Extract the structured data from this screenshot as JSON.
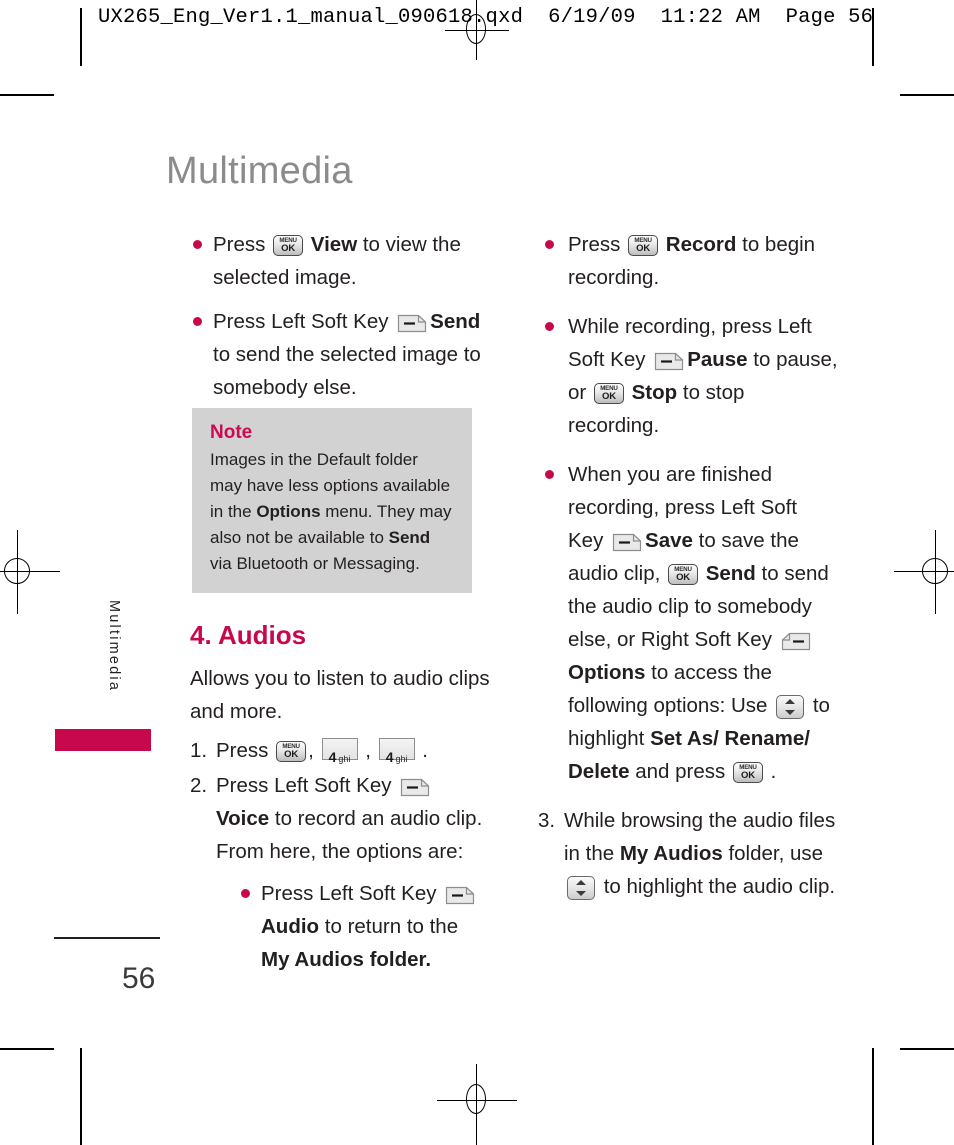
{
  "slug": "UX265_Eng_Ver1.1_manual_090618.qxd  6/19/09  11:22 AM  Page 56",
  "page_title": "Multimedia",
  "side_tab_label": "Multimedia",
  "page_number": "56",
  "accent_color": "#c8084c",
  "note_title_color": "#cc0a52",
  "note_bg_color": "#d2d2d2",
  "title_color": "#8b8b8b",
  "icons": {
    "menuok": {
      "line1": "MENU",
      "line2": "OK"
    },
    "left_soft_key": "left-soft-key",
    "right_soft_key": "right-soft-key",
    "nav_up_down": "up-down-nav-key",
    "key_4": {
      "digit": "4",
      "letters": "ghi"
    }
  },
  "left_column": {
    "bullets": [
      {
        "parts": [
          {
            "t": "text",
            "v": "Press "
          },
          {
            "t": "key",
            "v": "menuok"
          },
          {
            "t": "bold",
            "v": " View"
          },
          {
            "t": "text",
            "v": " to view the selected image."
          }
        ]
      },
      {
        "parts": [
          {
            "t": "text",
            "v": "Press Left Soft Key "
          },
          {
            "t": "key",
            "v": "leftsoft"
          },
          {
            "t": "bold",
            "v": "Send"
          },
          {
            "t": "text",
            "v": " to send the selected image to somebody else."
          }
        ]
      }
    ]
  },
  "note": {
    "title": "Note",
    "parts": [
      {
        "t": "text",
        "v": "Images in the Default folder may have less options available in the "
      },
      {
        "t": "bold",
        "v": "Options"
      },
      {
        "t": "text",
        "v": " menu. They may also not be available to "
      },
      {
        "t": "bold",
        "v": "Send"
      },
      {
        "t": "text",
        "v": " via Bluetooth or Messaging."
      }
    ]
  },
  "section": {
    "heading": "4. Audios",
    "intro": "Allows you to listen to audio clips and more.",
    "steps": [
      {
        "number": "1.",
        "parts": [
          {
            "t": "text",
            "v": "Press "
          },
          {
            "t": "key",
            "v": "menuok"
          },
          {
            "t": "text",
            "v": ", "
          },
          {
            "t": "key",
            "v": "key4"
          },
          {
            "t": "text",
            "v": " , "
          },
          {
            "t": "key",
            "v": "key4"
          },
          {
            "t": "text",
            "v": " ."
          }
        ]
      },
      {
        "number": "2.",
        "parts": [
          {
            "t": "text",
            "v": "Press Left Soft Key "
          },
          {
            "t": "key",
            "v": "leftsoft"
          },
          {
            "t": "bold",
            "v": " Voice"
          },
          {
            "t": "text",
            "v": " to record an audio clip. From here, the options are:"
          }
        ],
        "sub_bullets": [
          {
            "parts": [
              {
                "t": "text",
                "v": "Press Left Soft Key "
              },
              {
                "t": "key",
                "v": "leftsoft"
              },
              {
                "t": "bold",
                "v": "Audio"
              },
              {
                "t": "text",
                "v": " to return to the "
              },
              {
                "t": "bold",
                "v": "My Audios folder."
              }
            ]
          }
        ]
      }
    ]
  },
  "right_column": {
    "bullets": [
      {
        "parts": [
          {
            "t": "text",
            "v": "Press "
          },
          {
            "t": "key",
            "v": "menuok"
          },
          {
            "t": "bold",
            "v": " Record"
          },
          {
            "t": "text",
            "v": " to begin recording."
          }
        ]
      },
      {
        "parts": [
          {
            "t": "text",
            "v": "While recording, press Left Soft Key "
          },
          {
            "t": "key",
            "v": "leftsoft"
          },
          {
            "t": "bold",
            "v": "Pause"
          },
          {
            "t": "text",
            "v": " to pause, or "
          },
          {
            "t": "key",
            "v": "menuok"
          },
          {
            "t": "bold",
            "v": " Stop"
          },
          {
            "t": "text",
            "v": " to stop recording."
          }
        ]
      },
      {
        "parts": [
          {
            "t": "text",
            "v": "When you are finished recording, press Left Soft Key "
          },
          {
            "t": "key",
            "v": "leftsoft"
          },
          {
            "t": "bold",
            "v": "Save"
          },
          {
            "t": "text",
            "v": " to save the audio clip, "
          },
          {
            "t": "key",
            "v": "menuok"
          },
          {
            "t": "bold",
            "v": " Send"
          },
          {
            "t": "text",
            "v": " to send the audio clip to somebody else, or Right Soft Key "
          },
          {
            "t": "key",
            "v": "rightsoft"
          },
          {
            "t": "bold",
            "v": "Options"
          },
          {
            "t": "text",
            "v": " to access the following options: Use "
          },
          {
            "t": "key",
            "v": "nav"
          },
          {
            "t": "text",
            "v": " to highlight "
          },
          {
            "t": "bold",
            "v": "Set As/ Rename/ Delete"
          },
          {
            "t": "text",
            "v": " and press "
          },
          {
            "t": "key",
            "v": "menuok"
          },
          {
            "t": "text",
            "v": " ."
          }
        ]
      }
    ],
    "steps": [
      {
        "number": "3.",
        "parts": [
          {
            "t": "text",
            "v": "While browsing the audio files in the "
          },
          {
            "t": "bold",
            "v": "My Audios"
          },
          {
            "t": "text",
            "v": " folder, use "
          },
          {
            "t": "key",
            "v": "nav"
          },
          {
            "t": "text",
            "v": " to highlight the audio clip."
          }
        ]
      }
    ]
  }
}
